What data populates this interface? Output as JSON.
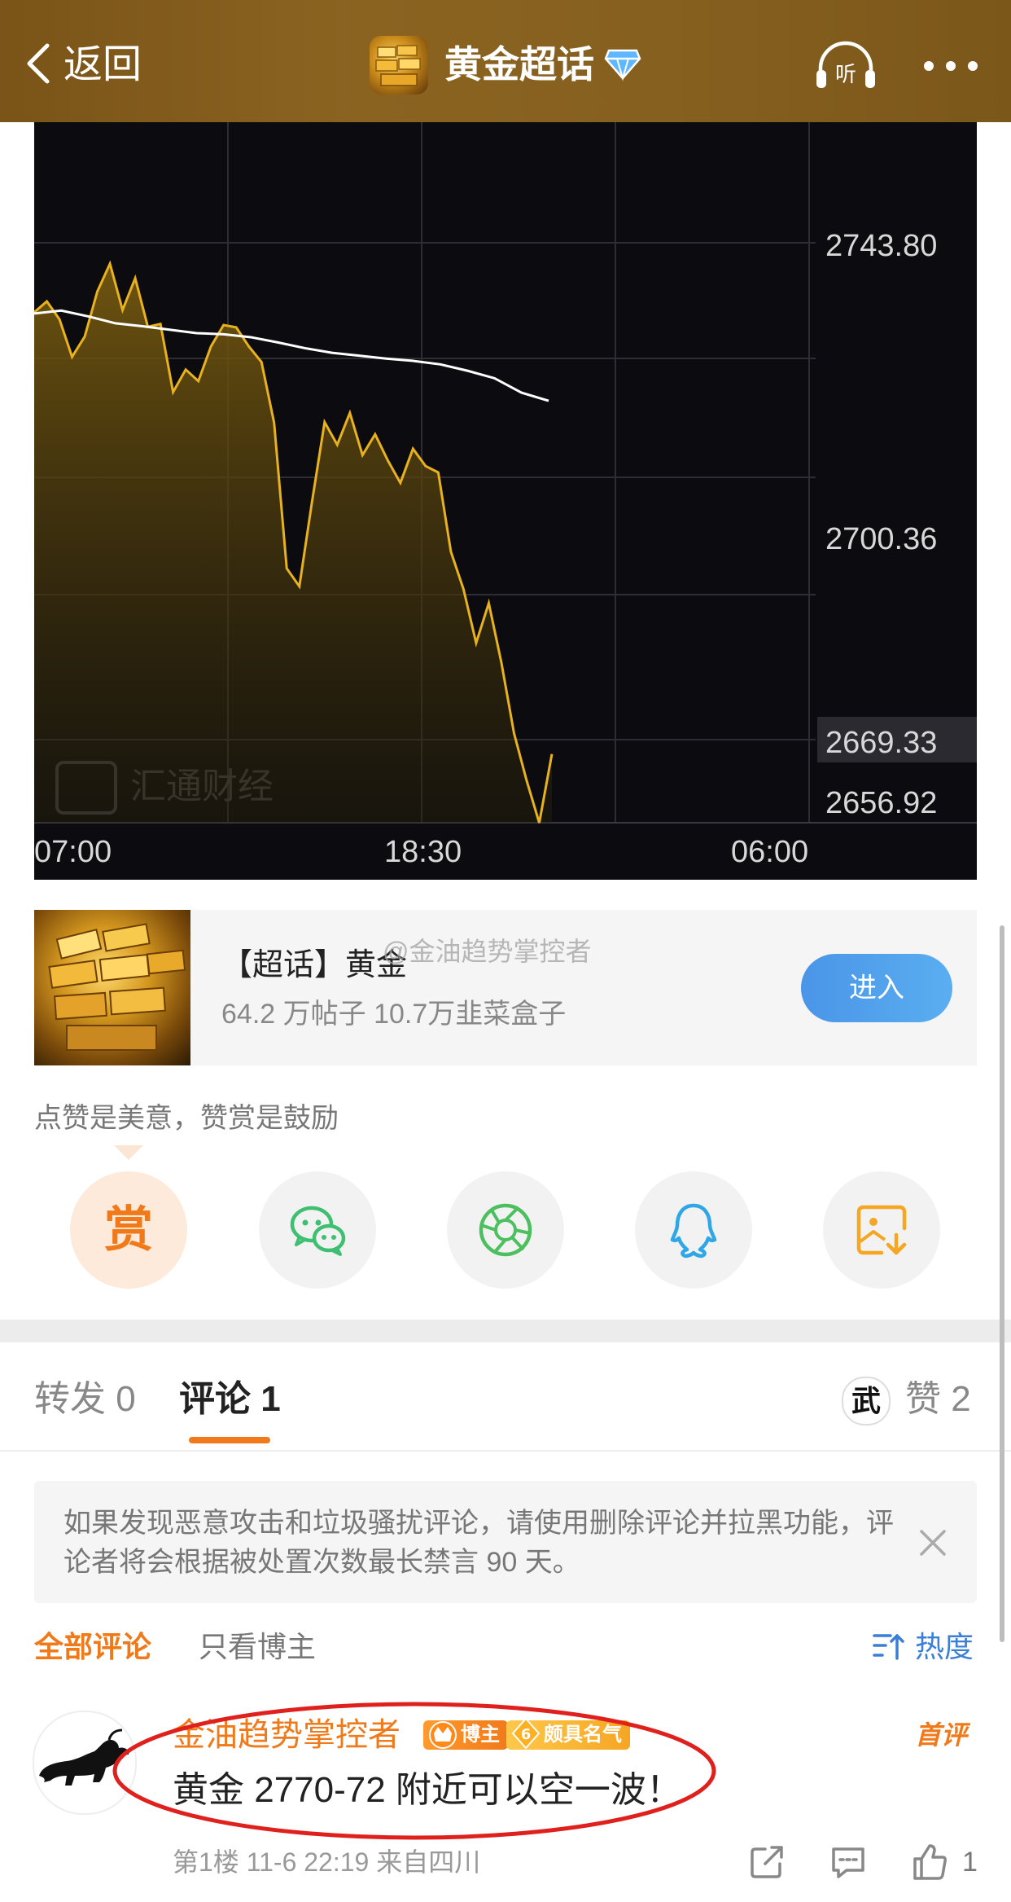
{
  "nav": {
    "back_label": "返回",
    "title": "黄金超话"
  },
  "chart_data": {
    "type": "area",
    "title": "",
    "xlabel": "",
    "ylabel": "",
    "x_tick_labels": [
      "07:00",
      "18:30",
      "06:00"
    ],
    "y_tick_labels": [
      "2743.80",
      "2700.36",
      "2669.33",
      "2656.92"
    ],
    "ylim": [
      2656.92,
      2764
    ],
    "grid": true,
    "watermark": "汇通财经",
    "series": [
      {
        "role": "price",
        "color": "#e8b21e",
        "values": [
          2745.2,
          2747.1,
          2744.0,
          2737.5,
          2741.0,
          2748.8,
          2753.6,
          2745.6,
          2751.1,
          2742.7,
          2743.2,
          2731.4,
          2735.3,
          2733.3,
          2739.3,
          2743.0,
          2742.6,
          2739.3,
          2736.6,
          2726.1,
          2700.9,
          2697.8,
          2712.4,
          2726.2,
          2722.3,
          2727.8,
          2720.5,
          2724.1,
          2719.6,
          2715.7,
          2721.6,
          2718.6,
          2717.5,
          2703.8,
          2697.3,
          2688.0,
          2694.9,
          2684.6,
          2672.4,
          2664.2,
          2656.9,
          2668.8
        ]
      },
      {
        "role": "average",
        "color": "#ffffff",
        "values": [
          2745.0,
          2745.5,
          2744.5,
          2743.3,
          2742.8,
          2742.2,
          2741.6,
          2741.4,
          2740.9,
          2740.0,
          2739.0,
          2738.2,
          2737.7,
          2737.2,
          2736.8,
          2736.2,
          2735.1,
          2733.8,
          2731.3,
          2729.9
        ]
      }
    ],
    "last_price_label": "2669.33"
  },
  "topic_card": {
    "title": "【超话】黄金",
    "stats": "64.2 万帖子 10.7万韭菜盒子",
    "watermark": "@金油趋势掌控者",
    "enter_label": "进入"
  },
  "reward": {
    "hint": "点赞是美意，赞赏是鼓励",
    "reward_glyph": "赏",
    "share_targets": [
      "reward-icon",
      "wechat-icon",
      "moments-icon",
      "qq-icon",
      "save-image-icon"
    ]
  },
  "tabs": {
    "repost": "转发 0",
    "comment": "评论 1",
    "like_avatar_glyph": "武",
    "likes": "赞 2"
  },
  "notice": {
    "text": "如果发现恶意攻击和垃圾骚扰评论，请使用删除评论并拉黑功能，评论者将会根据被处置次数最长禁言 90 天。"
  },
  "filters": {
    "all": "全部评论",
    "author_only": "只看博主",
    "sort": "热度"
  },
  "comment": {
    "user": "金油趋势掌控者",
    "badge_blogger": "博主",
    "badge_fame": "颇具名气",
    "badge_level": "6",
    "first_label": "首评",
    "text": "黄金 2770-72 附近可以空一波！",
    "meta": "第1楼 11-6 22:19 来自四川",
    "like_count": "1"
  },
  "colors": {
    "accent": "#f07a1a",
    "link": "#3a7fd5",
    "enter_button": "#4a95e8",
    "annotation": "#e0201c"
  }
}
